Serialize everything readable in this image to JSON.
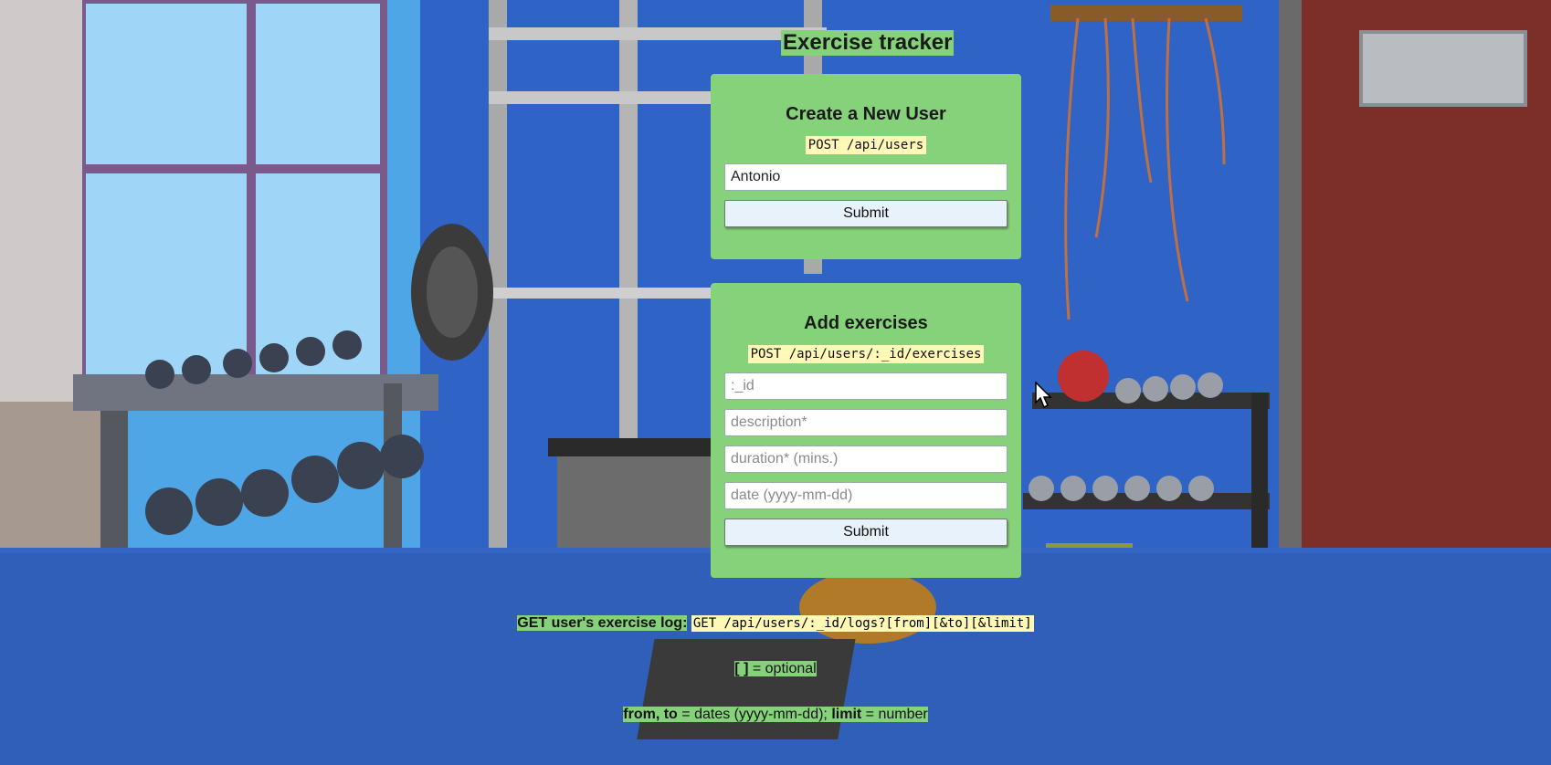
{
  "page": {
    "title": "Exercise tracker"
  },
  "create_user": {
    "heading": "Create a New User",
    "endpoint": "POST /api/users",
    "username_value": "Antonio",
    "submit_label": "Submit"
  },
  "add_exercise": {
    "heading": "Add exercises",
    "endpoint": "POST /api/users/:_id/exercises",
    "id_placeholder": ":_id",
    "description_placeholder": "description*",
    "duration_placeholder": "duration* (mins.)",
    "date_placeholder": "date (yyyy-mm-dd)",
    "submit_label": "Submit"
  },
  "log_info": {
    "label": "GET user's exercise log:",
    "endpoint": "GET /api/users/:_id/logs?[from][&to][&limit]",
    "optional_brackets": "[ ]",
    "optional_text": "= optional",
    "params_bold": "from, to",
    "params_dates": "= dates (yyyy-mm-dd);",
    "limit_bold": "limit",
    "limit_text": "= number"
  },
  "colors": {
    "panel_green": "#86d27b",
    "code_yellow": "#fff8b6",
    "button_bg": "#e8f2fb",
    "wall_blue": "#2f62c4"
  }
}
